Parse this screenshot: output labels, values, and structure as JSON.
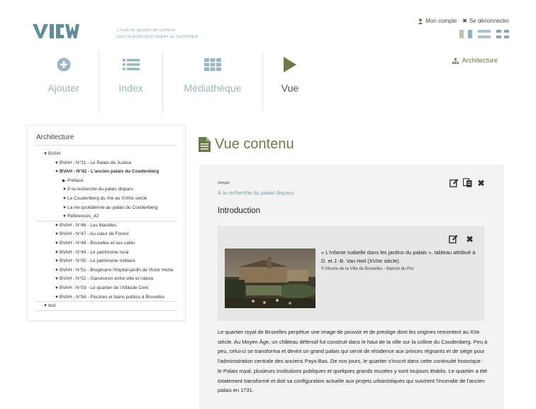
{
  "header": {
    "tagline_line1": "L'outil de gestion de contenu",
    "tagline_line2": "pour la publication papier ou numérique",
    "account_label": "Mon compte",
    "logout_label": "Se déconnecter"
  },
  "nav": {
    "items": [
      {
        "label": "Ajouter",
        "icon": "plus-circle-icon"
      },
      {
        "label": "Index",
        "icon": "list-icon"
      },
      {
        "label": "Médiathèque",
        "icon": "grid-icon"
      },
      {
        "label": "Vue",
        "icon": "play-icon"
      }
    ],
    "active": "Vue",
    "architecture_link": "Architecture"
  },
  "sidebar": {
    "title": "Architecture",
    "tree": {
      "root": "BVAH",
      "n31": "BVAH - N°31 - Le Palais de Justice",
      "n42": "BVAH - N°42 - L'ancien palais du Coudenberg",
      "preface": "Préface",
      "recherche": "À la recherche du palais disparu",
      "coudenberg": "Le Coudenberg du XIe au XVIIIe siècle",
      "quotidienne": "La vie quotidienne au palais du Coudenberg",
      "references": "Références_42",
      "n46": "BVAH - N°46 - Les Marolles",
      "n47": "BVAH - N°47 - Au cœur de Forest",
      "n48": "BVAH - N°48 - Bruxelles et ses cafés",
      "n49": "BVAH - N°49 - Le patrimoine rural",
      "n50": "BVAH - N°50 - Le patrimoine militaire",
      "n51": "BVAH - N°51 - Brugmann l'hôpital-jardin de Victor Horta",
      "n52": "BVAH - N°52 - Ganshoren entre ville et nature",
      "n53": "BVAH - N°53 - Le quartier de l'Altitude Cent",
      "n54": "BVAH - N°54 - Piscines et bains publics à Bruxelles",
      "test": "test"
    }
  },
  "main": {
    "heading": "Vue contenu",
    "type_label": "Simple",
    "breadcrumb_link": "À la recherche du palais disparu",
    "section_title": "Introduction",
    "image_caption": "« L'Infante Isabelle dans les jardins du palais », tableau attribué à D. et J.-B. Van Heil (XVIIe siècle).",
    "image_credit": "© Musée de la Ville de Bruxelles - Maison du Roi",
    "body": "Le quartier royal de Bruxelles perpétue une image de pouvoir et de prestige dont les origines remontent au XIIe siècle. Au Moyen Âge, un château défensif fut construit dans le haut de la ville sur la colline du Coudenberg. Peu à peu, celui-ci se transforma et devint un grand palais qui servit de résidence aux princes régnants et de siège pour l'administration centrale des anciens Pays-Bas. De nos jours, le quartier s'inscrit dans cette continuité historique : le Palais royal, plusieurs institutions publiques et quelques grands musées y sont toujours établis. Le quartier a été totalement transformé et doit sa configuration actuelle aux projets urbanistiques qui suivirent l'incendie de l'ancien palais en 1731."
  },
  "colors": {
    "olive_accent": "#6b7a46",
    "nav_blue": "#9ab6c1",
    "logo_blue": "#5f8e9a"
  }
}
